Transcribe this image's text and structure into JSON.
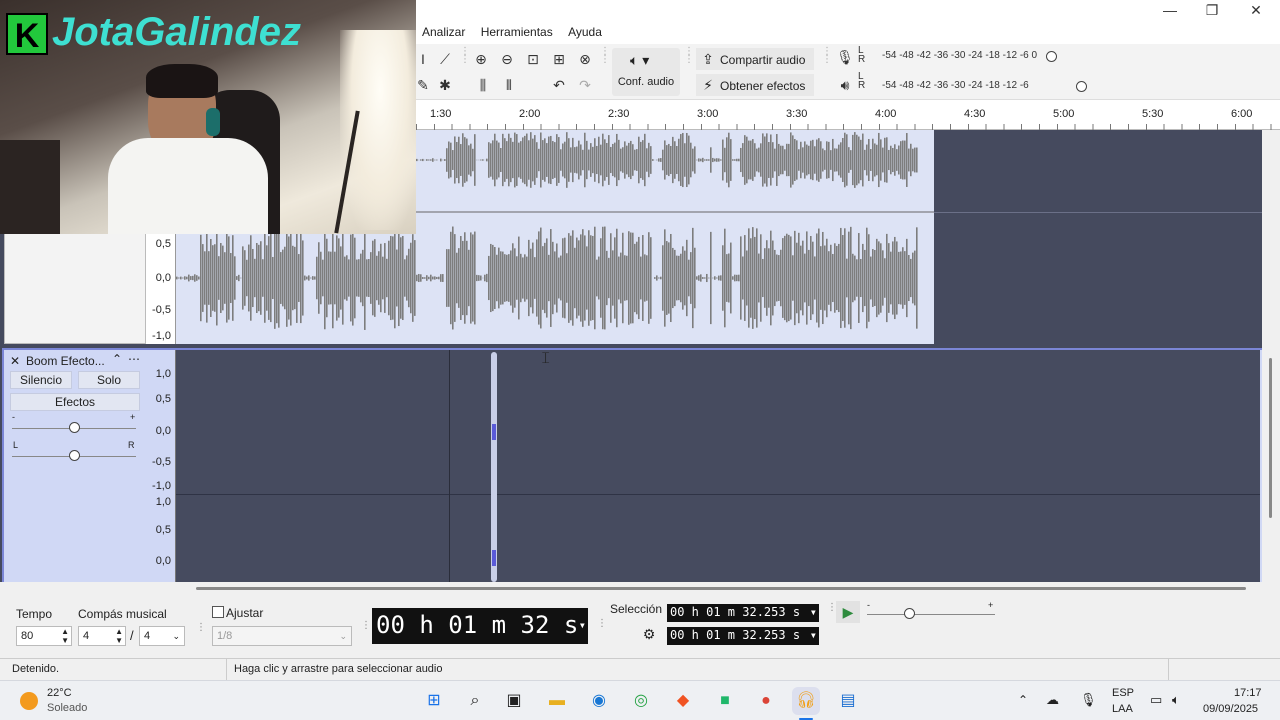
{
  "menu": [
    "Analizar",
    "Herramientas",
    "Ayuda"
  ],
  "window": {
    "minimize": "—",
    "maximize": "❐",
    "close": "✕"
  },
  "toolbar": {
    "audio_setup": "Conf. audio",
    "share_audio": "Compartir audio",
    "get_effects": "Obtener efectos",
    "record_meter_scale": "-54 -48 -42 -36 -30 -24 -18 -12 -6  0",
    "play_meter_scale": "-54 -48 -42 -36 -30 -24 -18 -12  -6",
    "lr_top": "L",
    "lr_bottom": "R"
  },
  "ruler": [
    "1:30",
    "2:00",
    "2:30",
    "3:00",
    "3:30",
    "4:00",
    "4:30",
    "5:00",
    "5:30",
    "6:00"
  ],
  "track1": {
    "scale": [
      "0,5",
      "0,0",
      "-0,5",
      "-1,0"
    ]
  },
  "track2": {
    "name": "Boom Efecto...",
    "mute": "Silencio",
    "solo": "Solo",
    "effects": "Efectos",
    "gain_minus": "-",
    "gain_plus": "+",
    "pan_left": "L",
    "pan_right": "R",
    "scale_top": [
      "1,0",
      "0,5",
      "0,0",
      "-0,5",
      "-1,0"
    ],
    "scale_bottom": [
      "1,0",
      "0,5",
      "0,0"
    ]
  },
  "bottom": {
    "tempo_label": "Tempo",
    "tempo_value": "80",
    "meter_label": "Compás musical",
    "meter_num": "4",
    "meter_sep": "/",
    "meter_den": "4",
    "snap_label": "Ajustar",
    "snap_value": "1/8",
    "time_display": "00 h 01 m 32 s",
    "selection_label": "Selección",
    "sel_start": "00 h 01 m 32.253 s",
    "sel_end": "00 h 01 m 32.253 s",
    "speed_minus": "-",
    "speed_plus": "+"
  },
  "status": {
    "state": "Detenido.",
    "hint": "Haga clic y arrastre para seleccionar audio"
  },
  "taskbar": {
    "weather_temp": "22°C",
    "weather_desc": "Soleado",
    "lang1": "ESP",
    "lang2": "LAA",
    "time": "17:17",
    "date": "09/09/2025"
  },
  "overlay": {
    "logo_k": "K",
    "logo_text": "JotaGalindez"
  },
  "colors": {
    "waveform": "#7d7d7d",
    "track_bg": "#dde3f5",
    "empty_bg": "#454a5e",
    "selected_border": "#7b86d6"
  }
}
